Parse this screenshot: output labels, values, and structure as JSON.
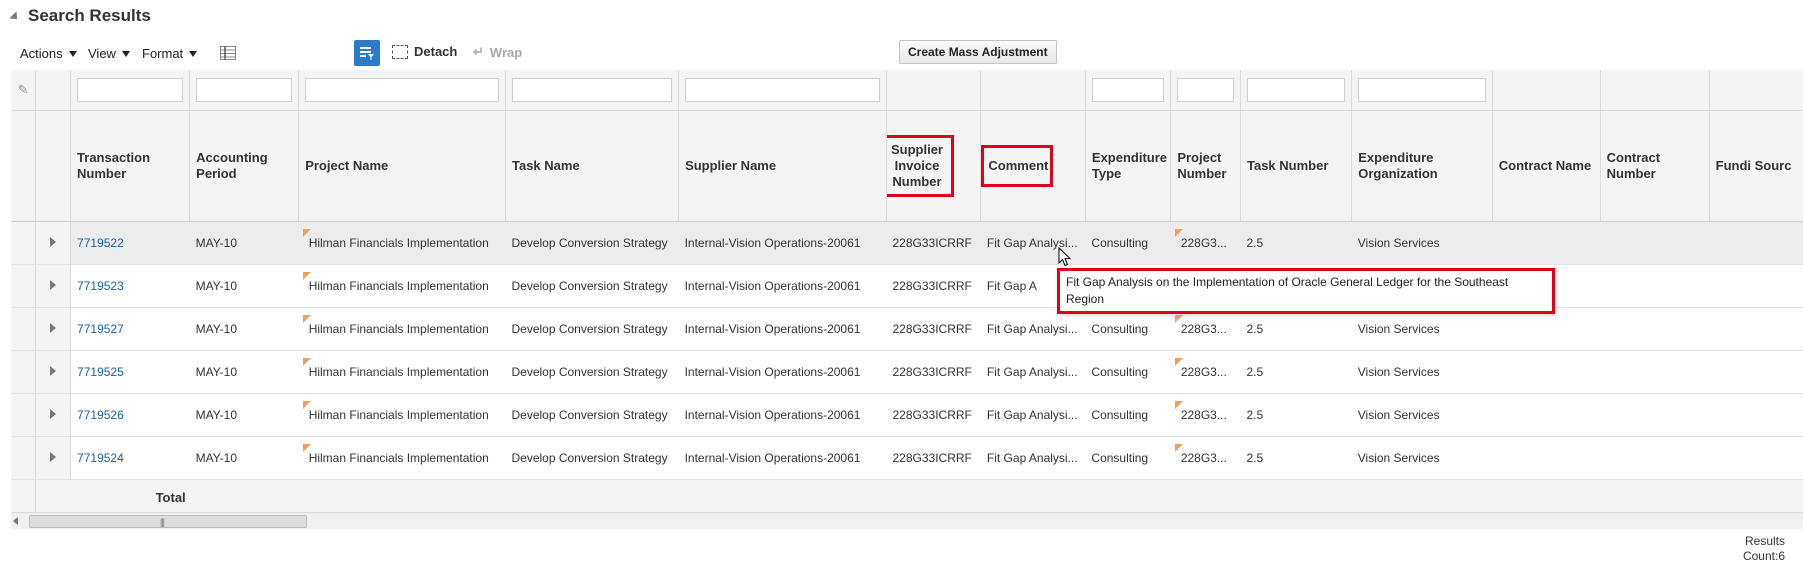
{
  "header": {
    "title": "Search Results"
  },
  "toolbar": {
    "actions_label": "Actions",
    "view_label": "View",
    "format_label": "Format",
    "detach_label": "Detach",
    "wrap_label": "Wrap",
    "mass_adjustment_label": "Create Mass Adjustment"
  },
  "columns": {
    "transaction_number": "Transaction Number",
    "accounting_period": "Accounting Period",
    "project_name": "Project Name",
    "task_name": "Task Name",
    "supplier_name": "Supplier Name",
    "supplier_invoice_number": "Supplier Invoice Number",
    "comment": "Comment",
    "expenditure_type": "Expenditure Type",
    "project_number": "Project Number",
    "task_number": "Task Number",
    "expenditure_organization": "Expenditure Organization",
    "contract_name": "Contract Name",
    "contract_number": "Contract Number",
    "funding_source": "Fundi Sourc"
  },
  "rows": [
    {
      "transaction_number": "7719522",
      "accounting_period": "MAY-10",
      "project_name": "Hilman Financials Implementation",
      "task_name": "Develop Conversion Strategy",
      "supplier_name": "Internal-Vision Operations-20061",
      "supplier_invoice_number": "228G33ICRRF",
      "comment": "Fit Gap Analysi...",
      "expenditure_type": "Consulting",
      "project_number": "228G3...",
      "task_number": "2.5",
      "expenditure_organization": "Vision Services"
    },
    {
      "transaction_number": "7719523",
      "accounting_period": "MAY-10",
      "project_name": "Hilman Financials Implementation",
      "task_name": "Develop Conversion Strategy",
      "supplier_name": "Internal-Vision Operations-20061",
      "supplier_invoice_number": "228G33ICRRF",
      "comment": "Fit Gap A",
      "expenditure_type": "",
      "project_number": "",
      "task_number": "",
      "expenditure_organization": ""
    },
    {
      "transaction_number": "7719527",
      "accounting_period": "MAY-10",
      "project_name": "Hilman Financials Implementation",
      "task_name": "Develop Conversion Strategy",
      "supplier_name": "Internal-Vision Operations-20061",
      "supplier_invoice_number": "228G33ICRRF",
      "comment": "Fit Gap Analysi...",
      "expenditure_type": "Consulting",
      "project_number": "228G3...",
      "task_number": "2.5",
      "expenditure_organization": "Vision Services"
    },
    {
      "transaction_number": "7719525",
      "accounting_period": "MAY-10",
      "project_name": "Hilman Financials Implementation",
      "task_name": "Develop Conversion Strategy",
      "supplier_name": "Internal-Vision Operations-20061",
      "supplier_invoice_number": "228G33ICRRF",
      "comment": "Fit Gap Analysi...",
      "expenditure_type": "Consulting",
      "project_number": "228G3...",
      "task_number": "2.5",
      "expenditure_organization": "Vision Services"
    },
    {
      "transaction_number": "7719526",
      "accounting_period": "MAY-10",
      "project_name": "Hilman Financials Implementation",
      "task_name": "Develop Conversion Strategy",
      "supplier_name": "Internal-Vision Operations-20061",
      "supplier_invoice_number": "228G33ICRRF",
      "comment": "Fit Gap Analysi...",
      "expenditure_type": "Consulting",
      "project_number": "228G3...",
      "task_number": "2.5",
      "expenditure_organization": "Vision Services"
    },
    {
      "transaction_number": "7719524",
      "accounting_period": "MAY-10",
      "project_name": "Hilman Financials Implementation",
      "task_name": "Develop Conversion Strategy",
      "supplier_name": "Internal-Vision Operations-20061",
      "supplier_invoice_number": "228G33ICRRF",
      "comment": "Fit Gap Analysi...",
      "expenditure_type": "Consulting",
      "project_number": "228G3...",
      "task_number": "2.5",
      "expenditure_organization": "Vision Services"
    }
  ],
  "total_label": "Total",
  "tooltip": {
    "text": "Fit Gap Analysis on the Implementation of Oracle General Ledger for the Southeast Region"
  },
  "footer": {
    "results_label": "Results",
    "count_label": "Count:6"
  },
  "colors": {
    "link": "#1a5fa8",
    "highlight": "#e0001a",
    "accent": "#2c7bc9",
    "flag": "#f0a05a"
  }
}
